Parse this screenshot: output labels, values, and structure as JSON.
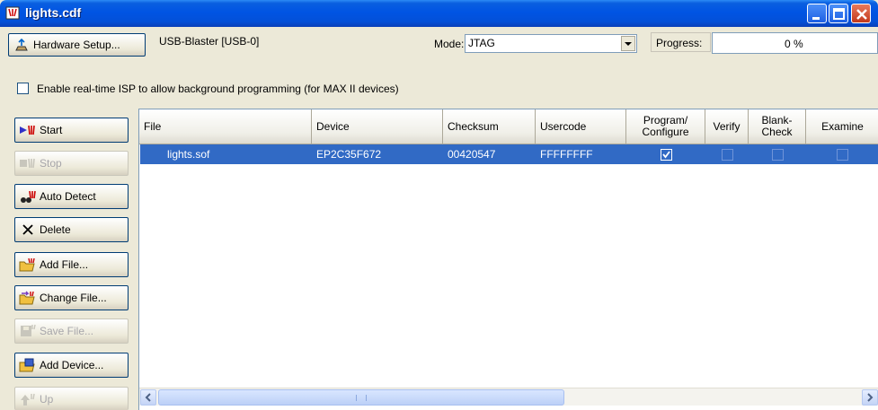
{
  "window": {
    "title": "lights.cdf"
  },
  "toolbar": {
    "hardware_setup_label": "Hardware Setup...",
    "hardware_value": "USB-Blaster [USB-0]",
    "mode_label": "Mode:",
    "mode_value": "JTAG",
    "progress_label": "Progress:",
    "progress_value": "0 %"
  },
  "isp": {
    "label": "Enable real-time ISP to allow background programming (for MAX II devices)",
    "checked": false
  },
  "side_buttons": [
    {
      "label": "Start",
      "icon": "start-icon",
      "enabled": true
    },
    {
      "label": "Stop",
      "icon": "stop-icon",
      "enabled": false
    },
    {
      "label": "Auto Detect",
      "icon": "auto-detect-icon",
      "enabled": true
    },
    {
      "label": "Delete",
      "icon": "delete-icon",
      "enabled": true
    },
    {
      "label": "Add File...",
      "icon": "add-file-icon",
      "enabled": true
    },
    {
      "label": "Change File...",
      "icon": "change-file-icon",
      "enabled": true
    },
    {
      "label": "Save File...",
      "icon": "save-file-icon",
      "enabled": false
    },
    {
      "label": "Add Device...",
      "icon": "add-device-icon",
      "enabled": true
    },
    {
      "label": "Up",
      "icon": "up-icon",
      "enabled": false
    }
  ],
  "table": {
    "columns": [
      "File",
      "Device",
      "Checksum",
      "Usercode",
      "Program/ Configure",
      "Verify",
      "Blank- Check",
      "Examine"
    ],
    "rows": [
      {
        "file": "lights.sof",
        "device": "EP2C35F672",
        "checksum": "00420547",
        "usercode": "FFFFFFFF",
        "program": true,
        "verify": false,
        "blank_check": false,
        "examine": false
      }
    ]
  },
  "colors": {
    "title_bar": "#0054e3",
    "selection": "#316ac5",
    "face": "#ece9d8"
  }
}
